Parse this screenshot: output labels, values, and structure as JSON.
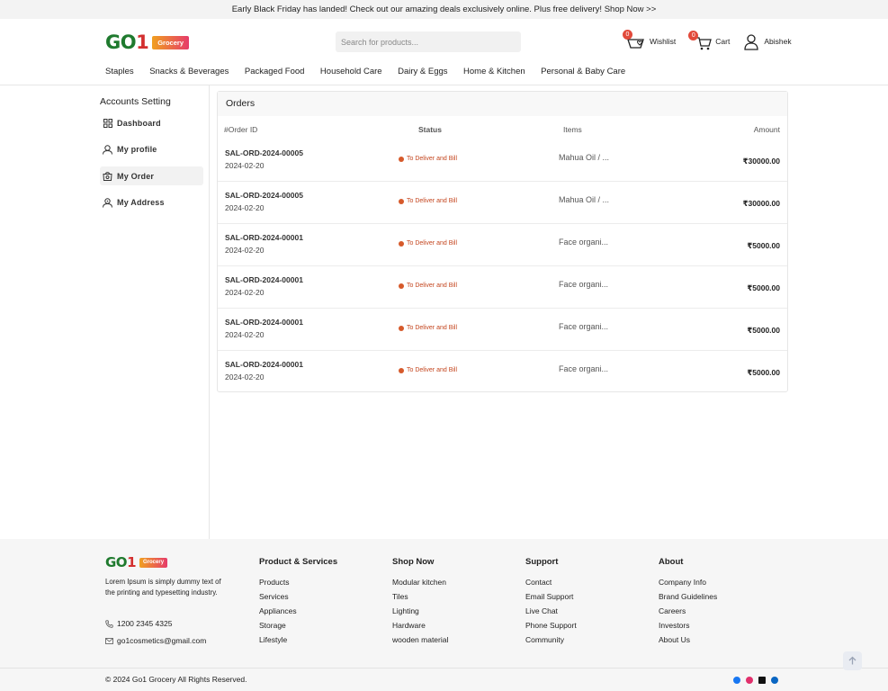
{
  "promo_text": "Early Black Friday has landed! Check out our amazing deals exclusively online. Plus free delivery! Shop Now >>",
  "brand": {
    "logo_main": "GO",
    "logo_one": "1",
    "logo_badge": "Grocery"
  },
  "search": {
    "placeholder": "Search for products..."
  },
  "header": {
    "wishlist": {
      "label": "Wishlist",
      "count": "0",
      "icon": "heart-basket-icon"
    },
    "cart": {
      "label": "Cart",
      "count": "0",
      "icon": "cart-icon"
    },
    "user": {
      "label": "Abishek",
      "icon": "user-icon"
    }
  },
  "nav": [
    "Staples",
    "Snacks & Beverages",
    "Packaged Food",
    "Household Care",
    "Dairy & Eggs",
    "Home & Kitchen",
    "Personal & Baby Care"
  ],
  "sidebar": {
    "title": "Accounts Setting",
    "items": [
      {
        "label": "Dashboard",
        "icon": "grid-icon",
        "active": false
      },
      {
        "label": "My profile",
        "icon": "user-icon",
        "active": false
      },
      {
        "label": "My Order",
        "icon": "bag-icon",
        "active": true
      },
      {
        "label": "My Address",
        "icon": "address-icon",
        "active": false
      }
    ]
  },
  "orders": {
    "title": "Orders",
    "columns": {
      "id": "#Order ID",
      "status": "Status",
      "items": "Items",
      "amount": "Amount"
    },
    "currency": "₹",
    "rows": [
      {
        "id": "SAL-ORD-2024-00005",
        "date": "2024-02-20",
        "status": "To Deliver and Bill",
        "items": "Mahua Oil / ...",
        "amount": "₹30000.00"
      },
      {
        "id": "SAL-ORD-2024-00005",
        "date": "2024-02-20",
        "status": "To Deliver and Bill",
        "items": "Mahua Oil / ...",
        "amount": "₹30000.00"
      },
      {
        "id": "SAL-ORD-2024-00001",
        "date": "2024-02-20",
        "status": "To Deliver and Bill",
        "items": "Face organi...",
        "amount": "₹5000.00"
      },
      {
        "id": "SAL-ORD-2024-00001",
        "date": "2024-02-20",
        "status": "To Deliver and Bill",
        "items": "Face organi...",
        "amount": "₹5000.00"
      },
      {
        "id": "SAL-ORD-2024-00001",
        "date": "2024-02-20",
        "status": "To Deliver and Bill",
        "items": "Face organi...",
        "amount": "₹5000.00"
      },
      {
        "id": "SAL-ORD-2024-00001",
        "date": "2024-02-20",
        "status": "To Deliver and Bill",
        "items": "Face organi...",
        "amount": "₹5000.00"
      }
    ]
  },
  "footer": {
    "description": "Lorem Ipsum is simply dummy text of the printing and typesetting industry.",
    "phone": "1200 2345 4325",
    "email": "go1cosmetics@gmail.com",
    "columns": [
      {
        "title": "Product & Services",
        "links": [
          "Products",
          "Services",
          "Appliances",
          "Storage",
          "Lifestyle"
        ]
      },
      {
        "title": "Shop Now",
        "links": [
          "Modular kitchen",
          "Tiles",
          "Lighting",
          "Hardware",
          "wooden material"
        ]
      },
      {
        "title": "Support",
        "links": [
          "Contact",
          "Email Support",
          "Live Chat",
          "Phone Support",
          "Community"
        ]
      },
      {
        "title": "About",
        "links": [
          "Company Info",
          "Brand Guidelines",
          "Careers",
          "Investors",
          "About Us"
        ]
      }
    ],
    "copyright": "© 2024 Go1 Grocery All Rights Reserved.",
    "social": [
      {
        "name": "facebook-icon",
        "color": "#1877f2"
      },
      {
        "name": "instagram-icon",
        "color": "#e1306c"
      },
      {
        "name": "x-icon",
        "color": "#111111"
      },
      {
        "name": "linkedin-icon",
        "color": "#0a66c2"
      }
    ]
  },
  "colors": {
    "status": "#c4461f",
    "badge": "#e24a3b",
    "accent_green": "#1f7a2e",
    "accent_red": "#d32f2f"
  }
}
